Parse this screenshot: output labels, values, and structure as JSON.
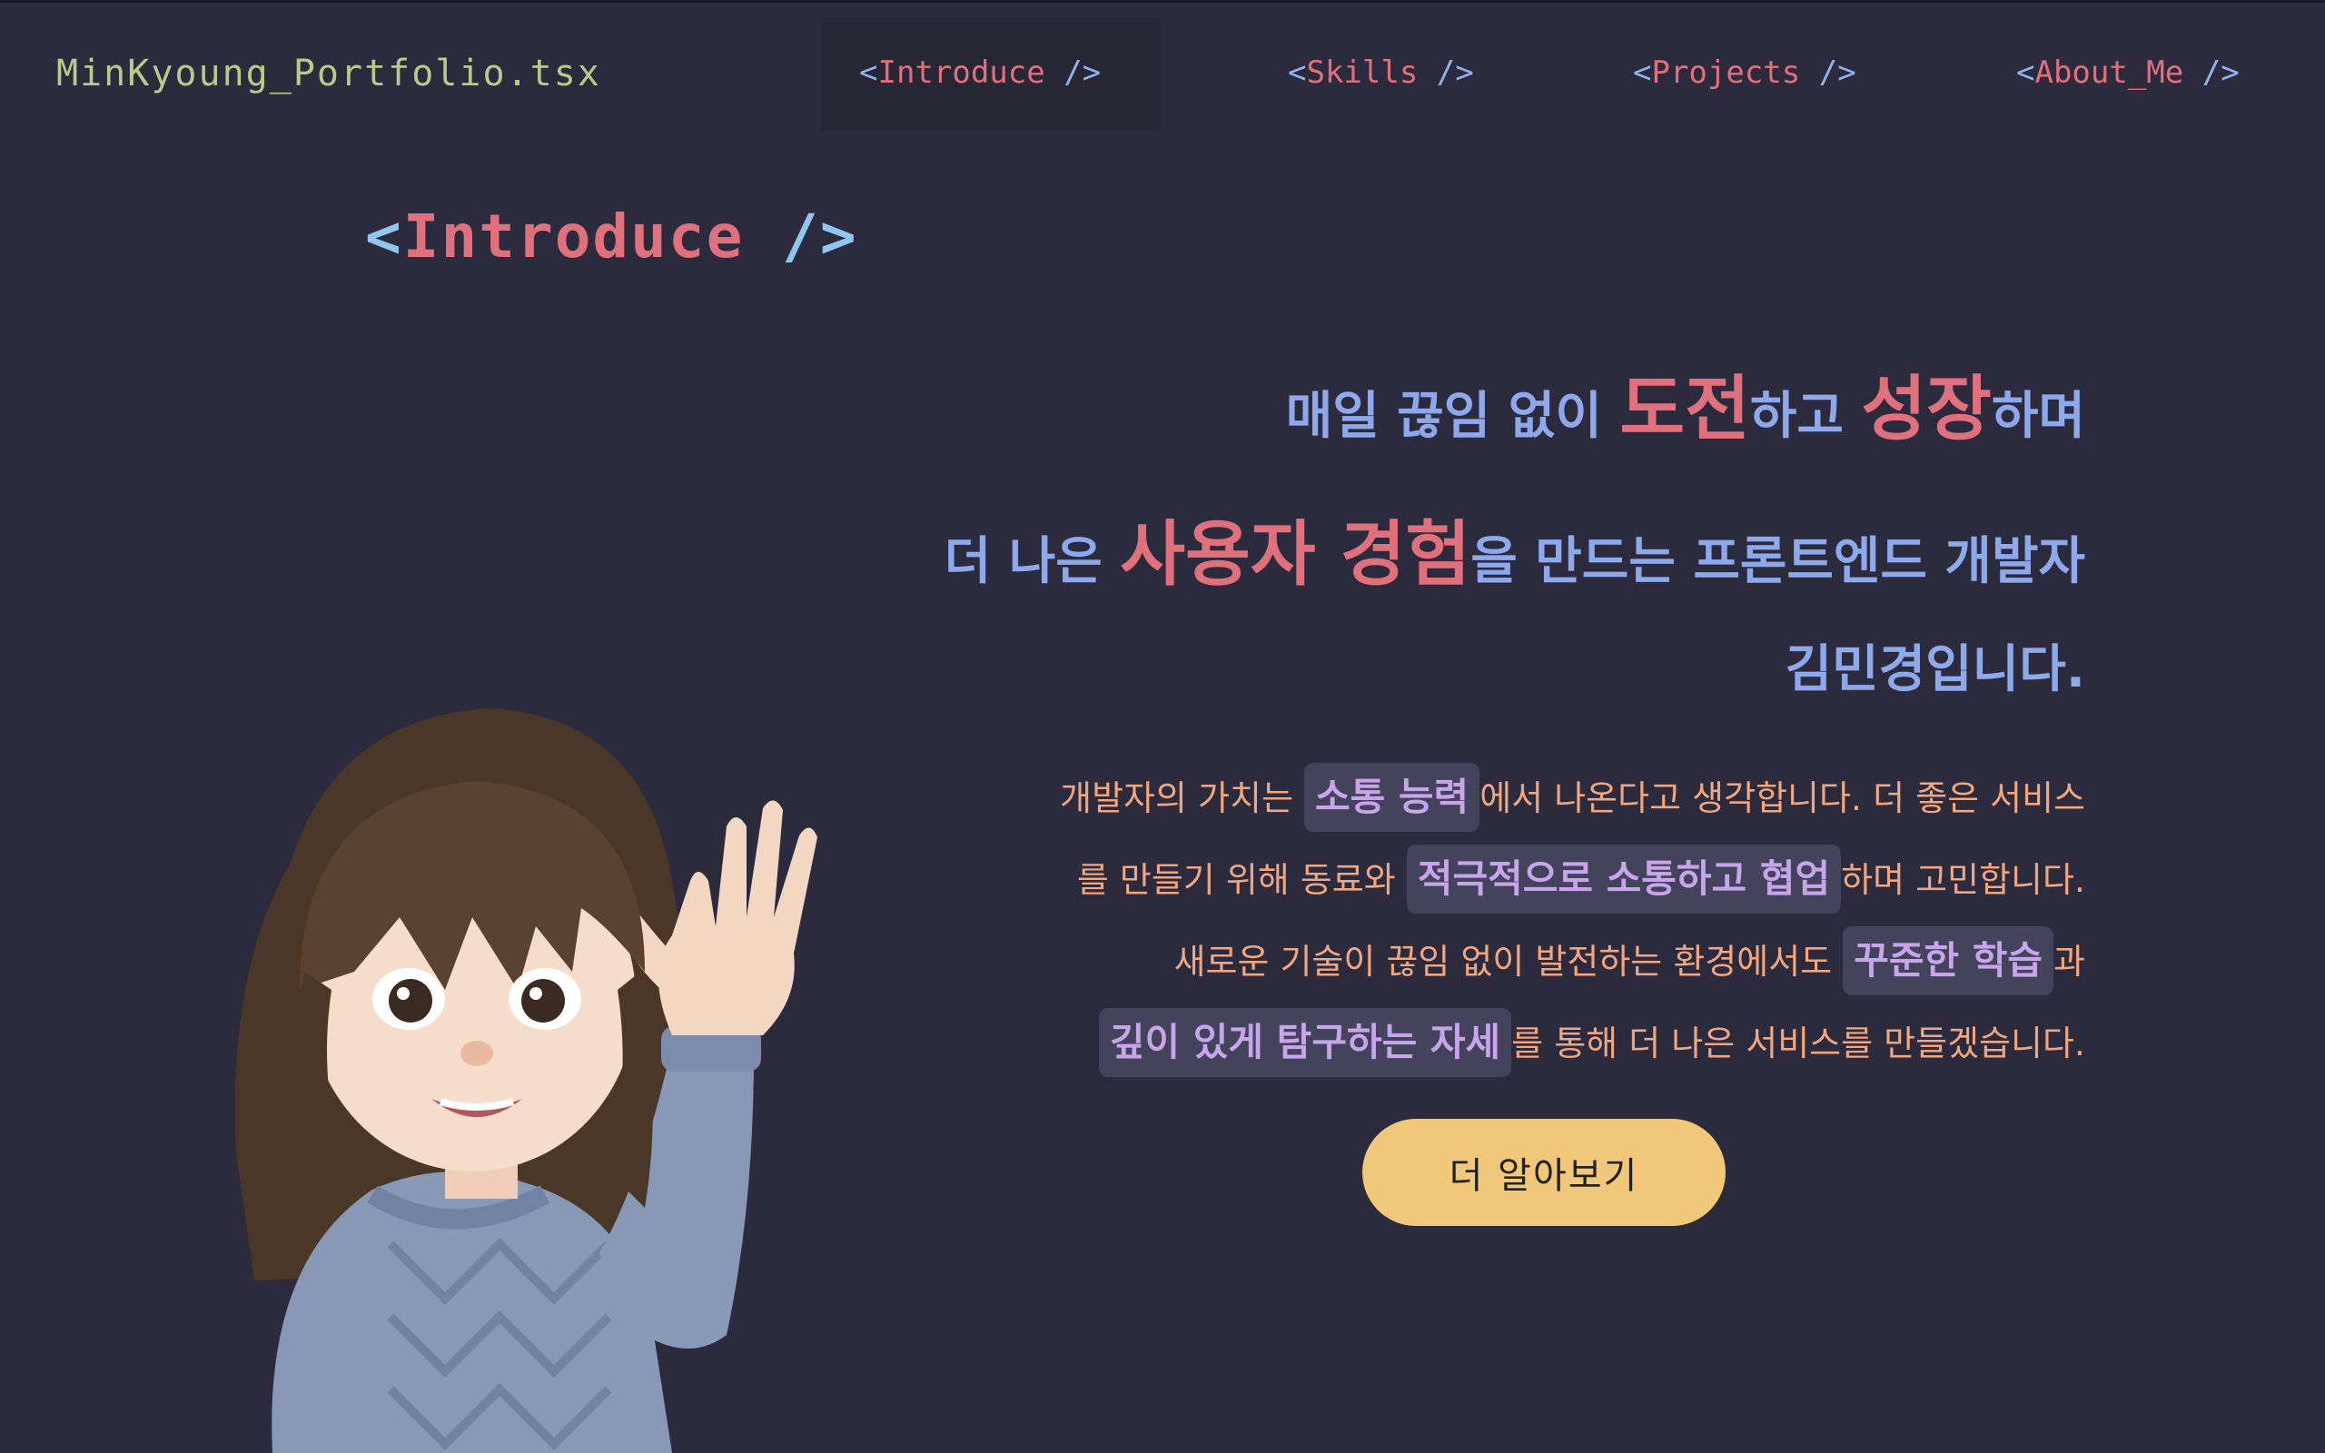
{
  "header": {
    "logo": "MinKyoung_Portfolio.tsx",
    "nav": [
      {
        "open": "<",
        "name": "Introduce",
        "close": " />"
      },
      {
        "open": "<",
        "name": "Skills",
        "close": " />"
      },
      {
        "open": "<",
        "name": "Projects",
        "close": " />"
      },
      {
        "open": "<",
        "name": "About_Me",
        "close": " />"
      }
    ]
  },
  "section": {
    "open": "<",
    "name": "Introduce",
    "close": " />"
  },
  "headline": {
    "line1": [
      "매일 끊임 없이 ",
      "도전",
      "하고 ",
      "성장",
      "하며"
    ],
    "line2": [
      "더 나은 ",
      "사용자 경험",
      "을 만드는 프론트엔드 개발자"
    ],
    "line3": "김민경입니다."
  },
  "intro": {
    "line1": [
      "개발자의 가치는 ",
      "소통 능력",
      "에서 나온다고 생각합니다. 더 좋은 서비스"
    ],
    "line2": [
      "를 만들기 위해 동료와 ",
      "적극적으로 소통하고 협업",
      "하며 고민합니다."
    ],
    "line3": [
      "새로운 기술이 끊임 없이 발전하는 환경에서도 ",
      "꾸준한 학습",
      "과"
    ],
    "line4": [
      "깊이 있게 탐구하는 자세",
      "를 통해 더 나은 서비스를 만들겠습니다."
    ]
  },
  "cta_label": "더 알아보기",
  "colors": {
    "background": "#2b2b3d",
    "accent_red": "#e0707c",
    "accent_blue": "#8ea8ec",
    "text_orange": "#f0a680",
    "tag_purple": "#c8a4ea",
    "button_yellow": "#f1c879",
    "logo_green": "#b9c98a"
  },
  "avatar_icon": "waving-girl-avatar"
}
